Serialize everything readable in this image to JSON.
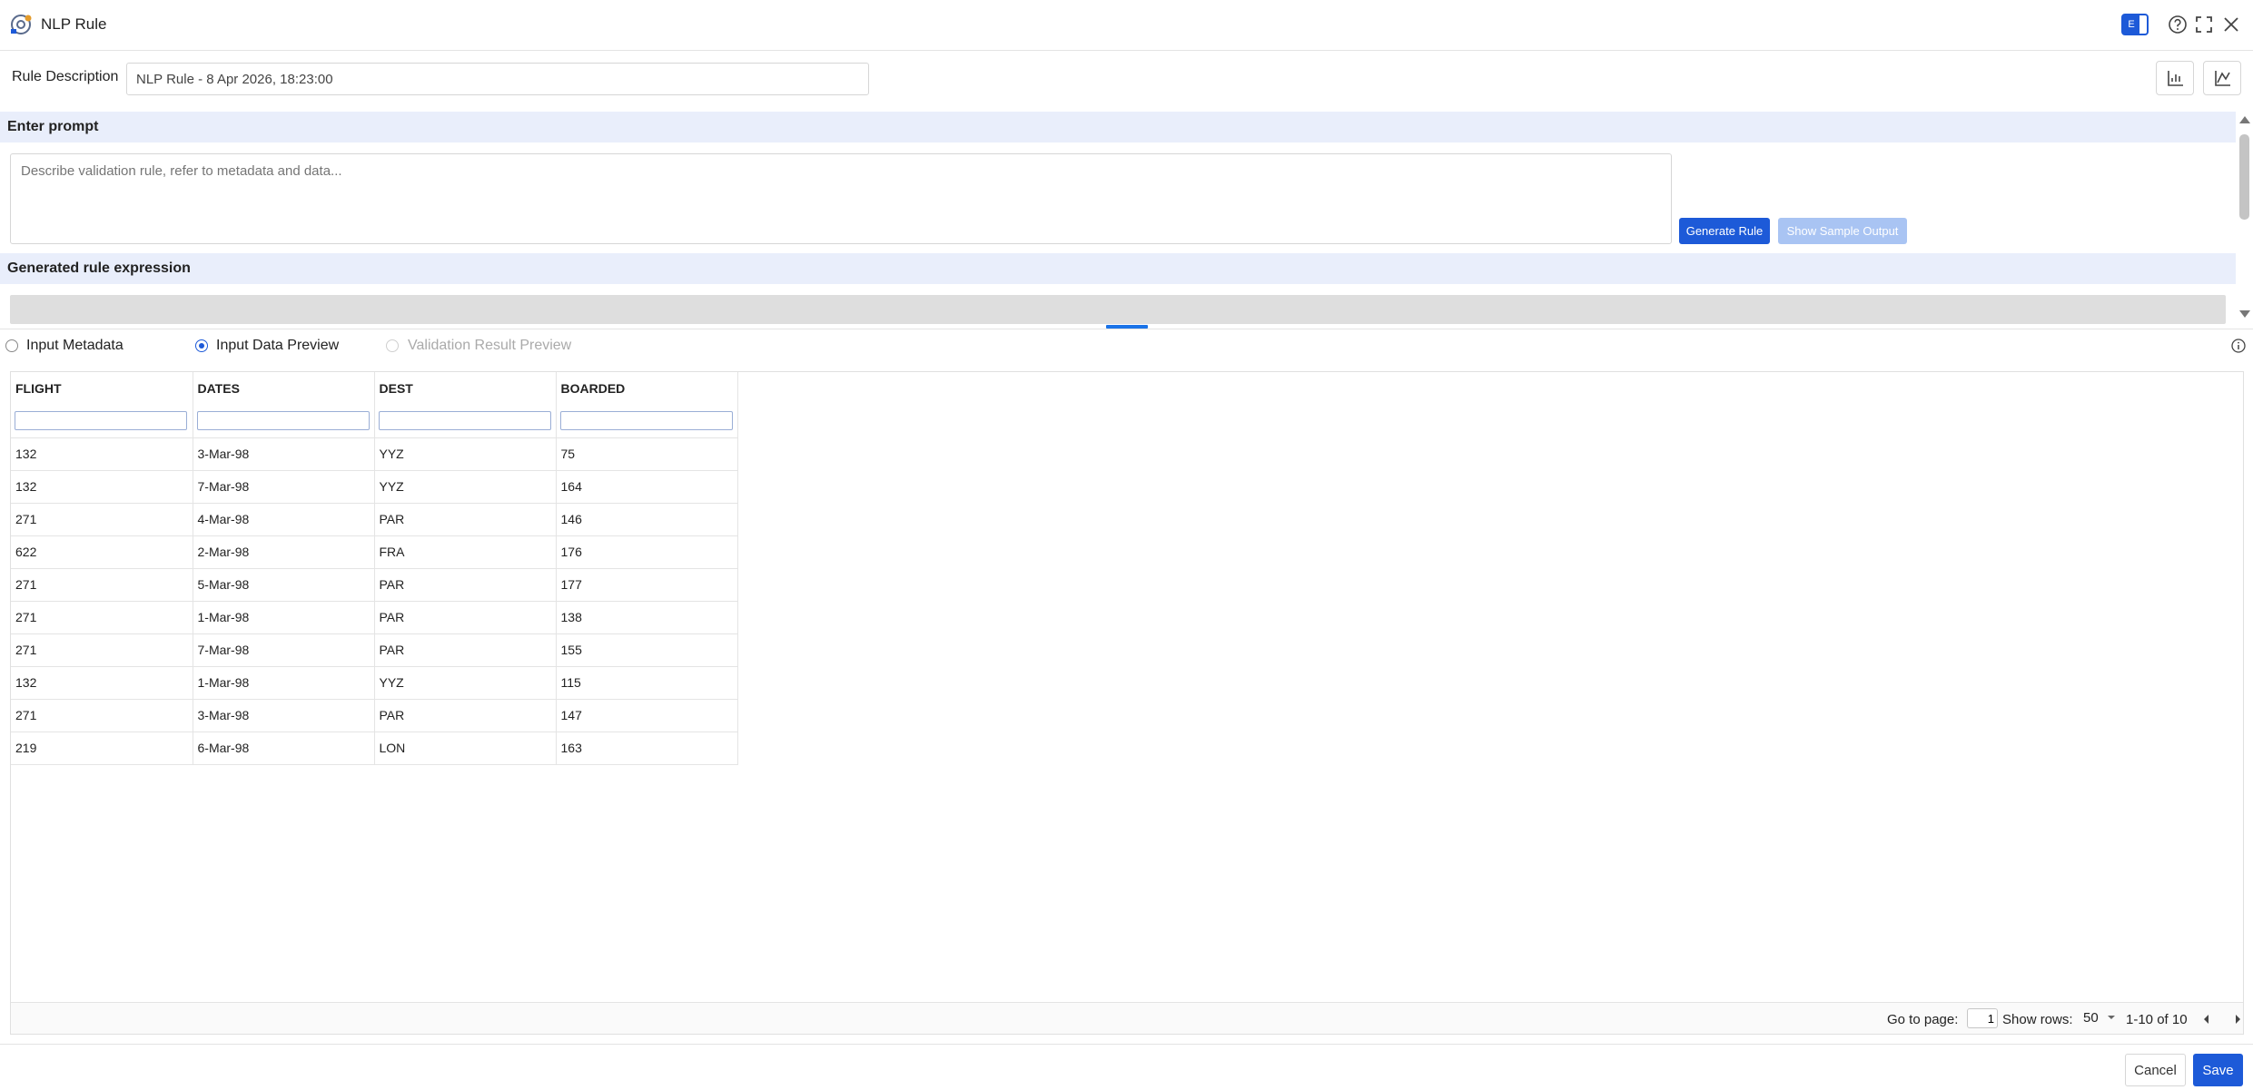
{
  "window": {
    "title": "NLP Rule",
    "toggle_label": "E"
  },
  "rule": {
    "description_label": "Rule Description",
    "description_value": "NLP Rule - 8 Apr 2026, 18:23:00"
  },
  "prompt": {
    "section_title": "Enter prompt",
    "placeholder": "Describe validation rule, refer to metadata and data...",
    "generate_label": "Generate Rule",
    "sample_label": "Show Sample Output"
  },
  "expression": {
    "section_title": "Generated rule expression"
  },
  "preview": {
    "options": [
      "Input Metadata",
      "Input Data Preview",
      "Validation Result Preview"
    ],
    "selected": "Input Data Preview"
  },
  "table": {
    "columns": [
      "FLIGHT",
      "DATES",
      "DEST",
      "BOARDED"
    ],
    "rows": [
      [
        "132",
        "3-Mar-98",
        "YYZ",
        "75"
      ],
      [
        "132",
        "7-Mar-98",
        "YYZ",
        "164"
      ],
      [
        "271",
        "4-Mar-98",
        "PAR",
        "146"
      ],
      [
        "622",
        "2-Mar-98",
        "FRA",
        "176"
      ],
      [
        "271",
        "5-Mar-98",
        "PAR",
        "177"
      ],
      [
        "271",
        "1-Mar-98",
        "PAR",
        "138"
      ],
      [
        "271",
        "7-Mar-98",
        "PAR",
        "155"
      ],
      [
        "132",
        "1-Mar-98",
        "YYZ",
        "115"
      ],
      [
        "271",
        "3-Mar-98",
        "PAR",
        "147"
      ],
      [
        "219",
        "6-Mar-98",
        "LON",
        "163"
      ]
    ]
  },
  "pager": {
    "goto_label": "Go to page:",
    "page_value": "1",
    "show_rows_label": "Show rows:",
    "rows_value": "50",
    "range_text": "1-10 of 10"
  },
  "footer": {
    "cancel_label": "Cancel",
    "save_label": "Save"
  },
  "colors": {
    "accent": "#1d5ad8",
    "section_bg": "#e9eefb"
  }
}
